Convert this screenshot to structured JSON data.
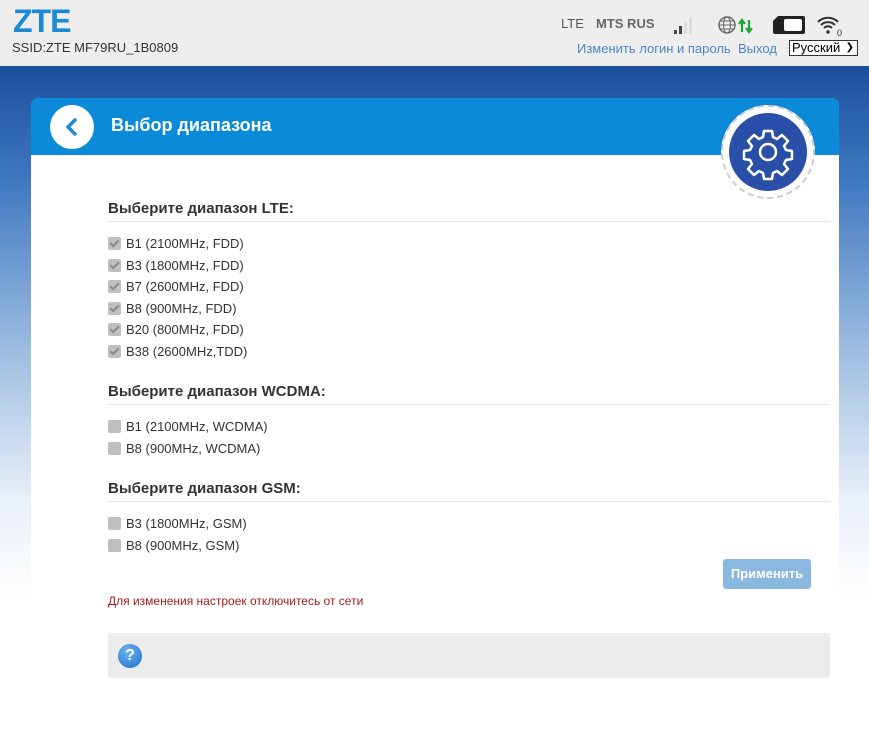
{
  "header": {
    "logo": "ZTE",
    "ssid": "SSID:ZTE MF79RU_1B0809",
    "network_type": "LTE",
    "operator": "MTS RUS",
    "wifi_clients": "0",
    "change_login_link": "Изменить логин и пароль",
    "logout_link": "Выход",
    "language": "Русский"
  },
  "page": {
    "title": "Выбор диапазона"
  },
  "lte": {
    "title": "Выберите диапазон LTE:",
    "bands": [
      {
        "label": "B1 (2100MHz, FDD)",
        "checked": true
      },
      {
        "label": "B3 (1800MHz, FDD)",
        "checked": true
      },
      {
        "label": "B7 (2600MHz, FDD)",
        "checked": true
      },
      {
        "label": "B8 (900MHz, FDD)",
        "checked": true
      },
      {
        "label": "B20 (800MHz, FDD)",
        "checked": true
      },
      {
        "label": "B38 (2600MHz,TDD)",
        "checked": true
      }
    ]
  },
  "wcdma": {
    "title": "Выберите диапазон WCDMA:",
    "bands": [
      {
        "label": "B1 (2100MHz, WCDMA)",
        "checked": false
      },
      {
        "label": "B8 (900MHz, WCDMA)",
        "checked": false
      }
    ]
  },
  "gsm": {
    "title": "Выберите диапазон GSM:",
    "bands": [
      {
        "label": "B3 (1800MHz, GSM)",
        "checked": false
      },
      {
        "label": "B8 (900MHz, GSM)",
        "checked": false
      }
    ]
  },
  "apply_label": "Применить",
  "warning": "Для изменения настроек отключитесь от сети",
  "help_icon": "?"
}
